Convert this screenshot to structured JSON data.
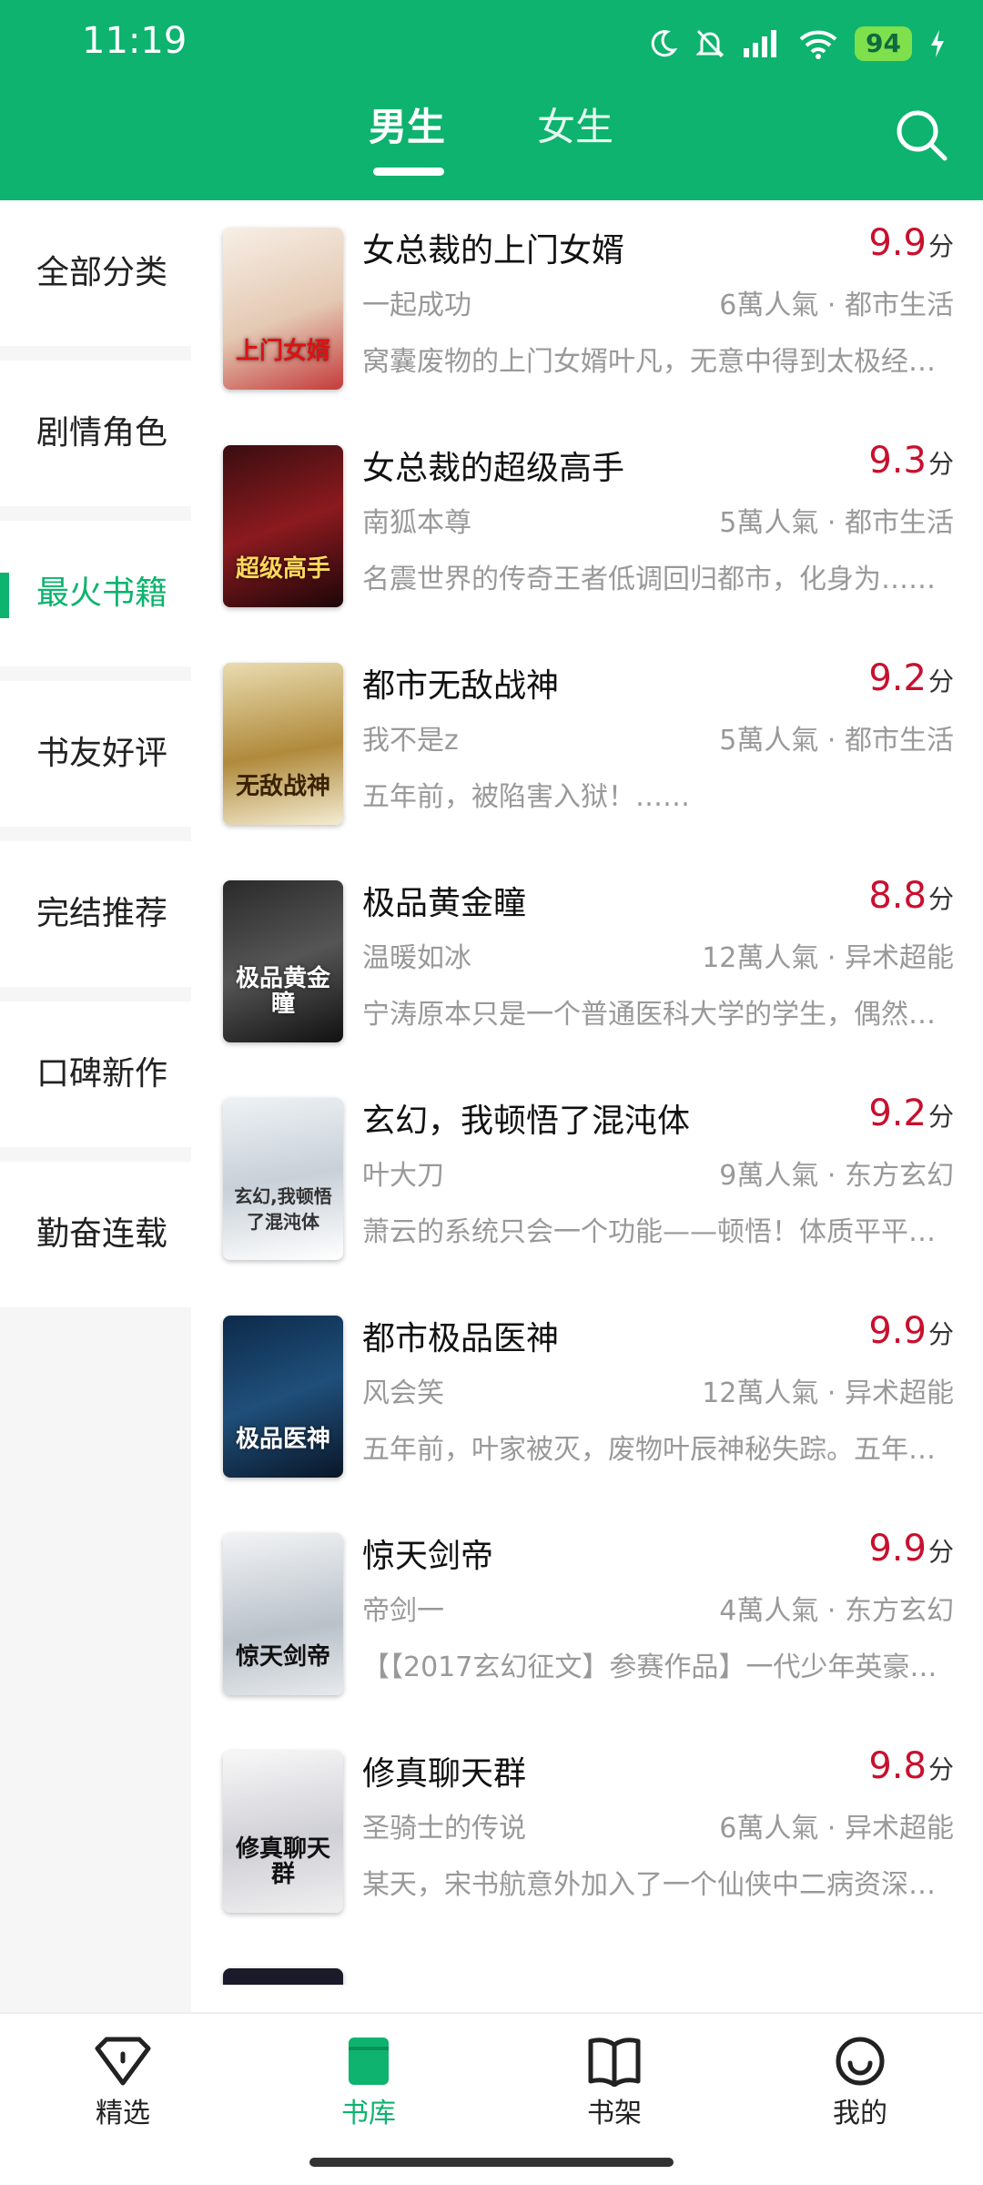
{
  "status": {
    "time": "11:19",
    "battery": "94"
  },
  "header": {
    "tabs": [
      {
        "label": "男生"
      },
      {
        "label": "女生"
      }
    ]
  },
  "sidebar": {
    "items": [
      {
        "label": "全部分类"
      },
      {
        "label": "剧情角色"
      },
      {
        "label": "最火书籍"
      },
      {
        "label": "书友好评"
      },
      {
        "label": "完结推荐"
      },
      {
        "label": "口碑新作"
      },
      {
        "label": "勤奋连载"
      }
    ],
    "active_index": 2
  },
  "score_unit": "分",
  "books": [
    {
      "title": "女总裁的上门女婿",
      "score": "9.9",
      "author": "一起成功",
      "meta": "6萬人氣 · 都市生活",
      "desc": "窝囊废物的上门女婿叶凡，无意中得到太极经……",
      "cover_text": "上门女婿"
    },
    {
      "title": "女总裁的超级高手",
      "score": "9.3",
      "author": "南狐本尊",
      "meta": "5萬人氣 · 都市生活",
      "desc": "名震世界的传奇王者低调回归都市，化身为……",
      "cover_text": "超级高手"
    },
    {
      "title": "都市无敌战神",
      "score": "9.2",
      "author": "我不是z",
      "meta": "5萬人氣 · 都市生活",
      "desc": "五年前，被陷害入狱！……",
      "cover_text": "无敌战神"
    },
    {
      "title": "极品黄金瞳",
      "score": "8.8",
      "author": "温暖如冰",
      "meta": "12萬人氣 · 异术超能",
      "desc": "宁涛原本只是一个普通医科大学的学生，偶然……",
      "cover_text": "极品黄金瞳"
    },
    {
      "title": "玄幻，我顿悟了混沌体",
      "score": "9.2",
      "author": "叶大刀",
      "meta": "9萬人氣 · 东方玄幻",
      "desc": "萧云的系统只会一个功能——顿悟！体质平平……",
      "cover_text": "玄幻,我顿悟了混沌体"
    },
    {
      "title": "都市极品医神",
      "score": "9.9",
      "author": "风会笑",
      "meta": "12萬人氣 · 异术超能",
      "desc": "五年前，叶家被灭，废物叶辰神秘失踪。五年后……",
      "cover_text": "极品医神"
    },
    {
      "title": "惊天剑帝",
      "score": "9.9",
      "author": "帝剑一",
      "meta": "4萬人氣 · 东方玄幻",
      "desc": "【【2017玄幻征文】参赛作品】一代少年英豪……",
      "cover_text": "惊天剑帝"
    },
    {
      "title": "修真聊天群",
      "score": "9.8",
      "author": "圣骑士的传说",
      "meta": "6萬人氣 · 异术超能",
      "desc": "某天，宋书航意外加入了一个仙侠中二病资深……",
      "cover_text": "修真聊天群"
    }
  ],
  "bottom_nav": [
    {
      "label": "精选",
      "icon": "diamond-icon"
    },
    {
      "label": "书库",
      "icon": "book-library-icon"
    },
    {
      "label": "书架",
      "icon": "open-book-icon"
    },
    {
      "label": "我的",
      "icon": "smiley-icon"
    }
  ],
  "colors": {
    "accent": "#0db36e",
    "score": "#c8102e"
  }
}
